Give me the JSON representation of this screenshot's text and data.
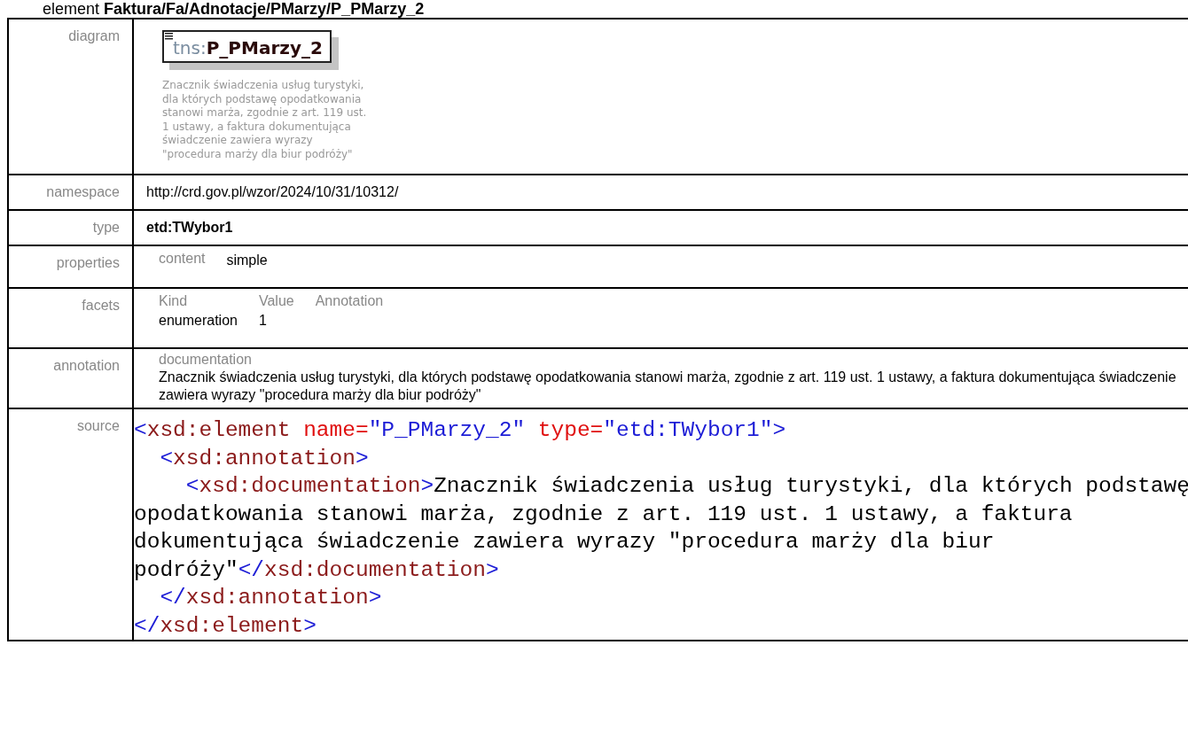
{
  "heading": "element **Faktura/Fa/Adnotacje/PMarzy/P_PMarzy_2**",
  "rows": [
    {
      "label": "diagram",
      "kind": "diagram",
      "element": {
        "prefix": "tns:",
        "name": "P_PMarzy_2"
      },
      "description": "Znacznik świadczenia usług turystyki, dla których podstawę opodatkowania stanowi marża, zgodnie z art. 119 ust. 1 ustawy, a faktura dokumentująca świadczenie zawiera wyrazy \"procedura marży dla biur podróży\""
    },
    {
      "label": "namespace",
      "kind": "text",
      "value": "http://crd.gov.pl/wzor/2024/10/31/10312/"
    },
    {
      "label": "type",
      "kind": "bold",
      "value": "etd:TWybor1"
    },
    {
      "label": "properties",
      "kind": "properties",
      "items": [
        {
          "key": "content",
          "value": "simple"
        }
      ]
    },
    {
      "label": "facets",
      "kind": "facets",
      "columns": [
        "Kind",
        "Value",
        "Annotation"
      ],
      "rows": [
        [
          "enumeration",
          "1"
        ]
      ]
    },
    {
      "label": "annotation",
      "kind": "annotation",
      "key": "documentation",
      "value": "Znacznik świadczenia usług turystyki, dla których podstawę opodatkowania stanowi marża, zgodnie z art. 119 ust. 1 ustawy, a faktura dokumentująca świadczenie zawiera wyrazy \"procedura marży dla biur podróży\""
    },
    {
      "label": "source",
      "kind": "source",
      "lines": [
        [
          {
            "kind": "bracket",
            "text": "<"
          },
          {
            "kind": "tag",
            "text": "xsd:element"
          },
          {
            "kind": "attr",
            "text": " name="
          },
          {
            "kind": "value",
            "text": "\"P_PMarzy_2\""
          },
          {
            "kind": "attr",
            "text": " type="
          },
          {
            "kind": "value",
            "text": "\"etd:TWybor1\""
          },
          {
            "kind": "bracket",
            "text": ">"
          }
        ],
        [
          {
            "kind": "bracket",
            "text": "  <"
          },
          {
            "kind": "tag",
            "text": "xsd:annotation"
          },
          {
            "kind": "bracket",
            "text": ">"
          }
        ],
        [
          {
            "kind": "bracket",
            "text": "    <"
          },
          {
            "kind": "tag",
            "text": "xsd:documentation"
          },
          {
            "kind": "bracket",
            "text": ">"
          },
          {
            "kind": "text",
            "text": "Znacznik świadczenia usług turystyki, dla których podstawę"
          }
        ],
        [
          {
            "kind": "text",
            "text": "opodatkowania stanowi marża, zgodnie z art. 119 ust. 1 ustawy, a faktura"
          }
        ],
        [
          {
            "kind": "text",
            "text": "dokumentująca świadczenie zawiera wyrazy \"procedura marży dla biur"
          }
        ],
        [
          {
            "kind": "text",
            "text": "podróży\""
          },
          {
            "kind": "bracket",
            "text": "</"
          },
          {
            "kind": "tag",
            "text": "xsd:documentation"
          },
          {
            "kind": "bracket",
            "text": ">"
          }
        ],
        [
          {
            "kind": "bracket",
            "text": "  </"
          },
          {
            "kind": "tag",
            "text": "xsd:annotation"
          },
          {
            "kind": "bracket",
            "text": ">"
          }
        ],
        [
          {
            "kind": "bracket",
            "text": "</"
          },
          {
            "kind": "tag",
            "text": "xsd:element"
          },
          {
            "kind": "bracket",
            "text": ">"
          }
        ]
      ]
    }
  ]
}
